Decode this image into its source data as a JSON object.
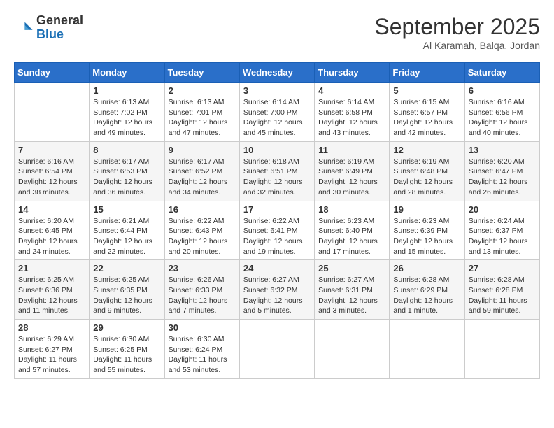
{
  "logo": {
    "general": "General",
    "blue": "Blue"
  },
  "title": "September 2025",
  "location": "Al Karamah, Balqa, Jordan",
  "days_of_week": [
    "Sunday",
    "Monday",
    "Tuesday",
    "Wednesday",
    "Thursday",
    "Friday",
    "Saturday"
  ],
  "weeks": [
    [
      {
        "day": "",
        "info": ""
      },
      {
        "day": "1",
        "info": "Sunrise: 6:13 AM\nSunset: 7:02 PM\nDaylight: 12 hours\nand 49 minutes."
      },
      {
        "day": "2",
        "info": "Sunrise: 6:13 AM\nSunset: 7:01 PM\nDaylight: 12 hours\nand 47 minutes."
      },
      {
        "day": "3",
        "info": "Sunrise: 6:14 AM\nSunset: 7:00 PM\nDaylight: 12 hours\nand 45 minutes."
      },
      {
        "day": "4",
        "info": "Sunrise: 6:14 AM\nSunset: 6:58 PM\nDaylight: 12 hours\nand 43 minutes."
      },
      {
        "day": "5",
        "info": "Sunrise: 6:15 AM\nSunset: 6:57 PM\nDaylight: 12 hours\nand 42 minutes."
      },
      {
        "day": "6",
        "info": "Sunrise: 6:16 AM\nSunset: 6:56 PM\nDaylight: 12 hours\nand 40 minutes."
      }
    ],
    [
      {
        "day": "7",
        "info": "Sunrise: 6:16 AM\nSunset: 6:54 PM\nDaylight: 12 hours\nand 38 minutes."
      },
      {
        "day": "8",
        "info": "Sunrise: 6:17 AM\nSunset: 6:53 PM\nDaylight: 12 hours\nand 36 minutes."
      },
      {
        "day": "9",
        "info": "Sunrise: 6:17 AM\nSunset: 6:52 PM\nDaylight: 12 hours\nand 34 minutes."
      },
      {
        "day": "10",
        "info": "Sunrise: 6:18 AM\nSunset: 6:51 PM\nDaylight: 12 hours\nand 32 minutes."
      },
      {
        "day": "11",
        "info": "Sunrise: 6:19 AM\nSunset: 6:49 PM\nDaylight: 12 hours\nand 30 minutes."
      },
      {
        "day": "12",
        "info": "Sunrise: 6:19 AM\nSunset: 6:48 PM\nDaylight: 12 hours\nand 28 minutes."
      },
      {
        "day": "13",
        "info": "Sunrise: 6:20 AM\nSunset: 6:47 PM\nDaylight: 12 hours\nand 26 minutes."
      }
    ],
    [
      {
        "day": "14",
        "info": "Sunrise: 6:20 AM\nSunset: 6:45 PM\nDaylight: 12 hours\nand 24 minutes."
      },
      {
        "day": "15",
        "info": "Sunrise: 6:21 AM\nSunset: 6:44 PM\nDaylight: 12 hours\nand 22 minutes."
      },
      {
        "day": "16",
        "info": "Sunrise: 6:22 AM\nSunset: 6:43 PM\nDaylight: 12 hours\nand 20 minutes."
      },
      {
        "day": "17",
        "info": "Sunrise: 6:22 AM\nSunset: 6:41 PM\nDaylight: 12 hours\nand 19 minutes."
      },
      {
        "day": "18",
        "info": "Sunrise: 6:23 AM\nSunset: 6:40 PM\nDaylight: 12 hours\nand 17 minutes."
      },
      {
        "day": "19",
        "info": "Sunrise: 6:23 AM\nSunset: 6:39 PM\nDaylight: 12 hours\nand 15 minutes."
      },
      {
        "day": "20",
        "info": "Sunrise: 6:24 AM\nSunset: 6:37 PM\nDaylight: 12 hours\nand 13 minutes."
      }
    ],
    [
      {
        "day": "21",
        "info": "Sunrise: 6:25 AM\nSunset: 6:36 PM\nDaylight: 12 hours\nand 11 minutes."
      },
      {
        "day": "22",
        "info": "Sunrise: 6:25 AM\nSunset: 6:35 PM\nDaylight: 12 hours\nand 9 minutes."
      },
      {
        "day": "23",
        "info": "Sunrise: 6:26 AM\nSunset: 6:33 PM\nDaylight: 12 hours\nand 7 minutes."
      },
      {
        "day": "24",
        "info": "Sunrise: 6:27 AM\nSunset: 6:32 PM\nDaylight: 12 hours\nand 5 minutes."
      },
      {
        "day": "25",
        "info": "Sunrise: 6:27 AM\nSunset: 6:31 PM\nDaylight: 12 hours\nand 3 minutes."
      },
      {
        "day": "26",
        "info": "Sunrise: 6:28 AM\nSunset: 6:29 PM\nDaylight: 12 hours\nand 1 minute."
      },
      {
        "day": "27",
        "info": "Sunrise: 6:28 AM\nSunset: 6:28 PM\nDaylight: 11 hours\nand 59 minutes."
      }
    ],
    [
      {
        "day": "28",
        "info": "Sunrise: 6:29 AM\nSunset: 6:27 PM\nDaylight: 11 hours\nand 57 minutes."
      },
      {
        "day": "29",
        "info": "Sunrise: 6:30 AM\nSunset: 6:25 PM\nDaylight: 11 hours\nand 55 minutes."
      },
      {
        "day": "30",
        "info": "Sunrise: 6:30 AM\nSunset: 6:24 PM\nDaylight: 11 hours\nand 53 minutes."
      },
      {
        "day": "",
        "info": ""
      },
      {
        "day": "",
        "info": ""
      },
      {
        "day": "",
        "info": ""
      },
      {
        "day": "",
        "info": ""
      }
    ]
  ]
}
